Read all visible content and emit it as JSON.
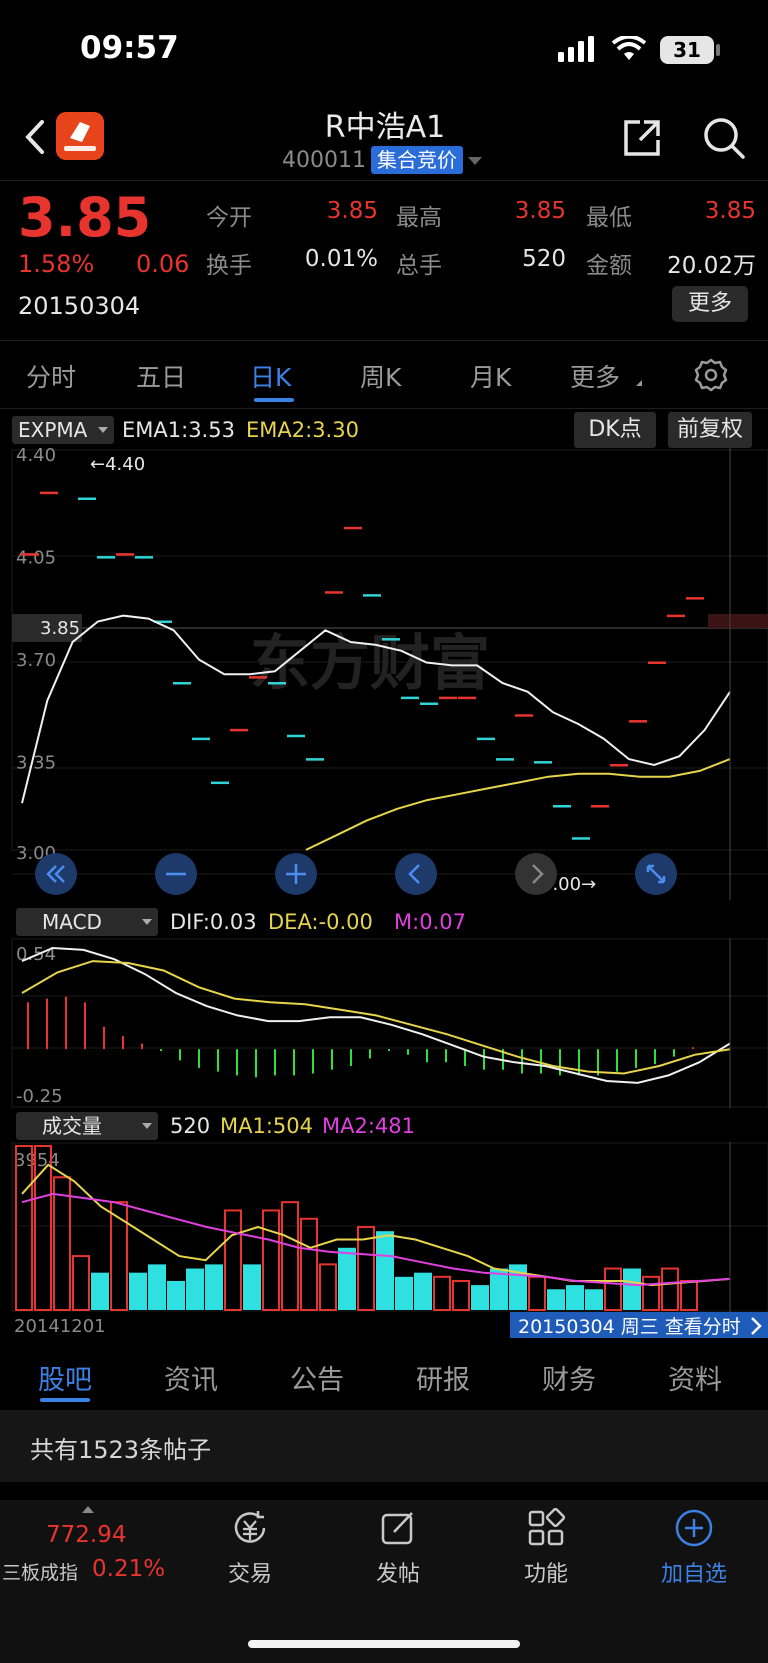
{
  "status_bar": {
    "time": "09:57",
    "battery": "31"
  },
  "header": {
    "title": "R中浩A1",
    "code": "400011",
    "badge": "集合竞价"
  },
  "quote": {
    "price": "3.85",
    "change_pct": "1.58%",
    "change": "0.06",
    "date": "20150304",
    "fields": [
      {
        "label": "今开",
        "value": "3.85",
        "color": "#e8342e"
      },
      {
        "label": "最高",
        "value": "3.85",
        "color": "#e8342e"
      },
      {
        "label": "最低",
        "value": "3.85",
        "color": "#e8342e"
      },
      {
        "label": "换手",
        "value": "0.01%",
        "color": "#e6e6e6"
      },
      {
        "label": "总手",
        "value": "520",
        "color": "#e6e6e6"
      },
      {
        "label": "金额",
        "value": "20.02万",
        "color": "#e6e6e6"
      }
    ],
    "more_label": "更多"
  },
  "ktabs": [
    "分时",
    "五日",
    "日K",
    "周K",
    "月K",
    "更多"
  ],
  "main_chart": {
    "indicator": "EXPMA",
    "ema1": "EMA1:3.53",
    "ema2": "EMA2:3.30",
    "dk_label": "DK点",
    "adjust_label": "前复权",
    "y_labels": [
      "4.40",
      "4.05",
      "3.70",
      "3.35",
      "3.00"
    ],
    "max_marker": "←4.40",
    "min_marker": "3.00→",
    "current_price": "3.85",
    "watermark": "东方财富"
  },
  "macd": {
    "indicator": "MACD",
    "dif": "DIF:0.03",
    "dea": "DEA:-0.00",
    "m": "M:0.07",
    "y_labels": [
      "0.54",
      "-0.25"
    ]
  },
  "volume": {
    "indicator": "成交量",
    "value": "520",
    "ma1": "MA1:504",
    "ma2": "MA2:481",
    "y_label": "3954",
    "start_date": "20141201",
    "end_label": "20150304 周三 查看分时"
  },
  "chart_data": {
    "type": "candlestick",
    "kline": [
      {
        "open": 4.0,
        "close": 4.0
      },
      {
        "open": 4.21,
        "close": 4.21
      },
      {
        "open": 4.4,
        "close": 4.4
      },
      {
        "open": 4.19,
        "close": 4.19
      },
      {
        "open": 3.99,
        "close": 3.99
      },
      {
        "open": 4.0,
        "close": 4.0
      },
      {
        "open": 3.99,
        "close": 3.99
      },
      {
        "open": 3.77,
        "close": 3.77
      },
      {
        "open": 3.56,
        "close": 3.56
      },
      {
        "open": 3.37,
        "close": 3.37
      },
      {
        "open": 3.22,
        "close": 3.22
      },
      {
        "open": 3.4,
        "close": 3.4
      },
      {
        "open": 3.58,
        "close": 3.58
      },
      {
        "open": 3.56,
        "close": 3.56
      },
      {
        "open": 3.38,
        "close": 3.38
      },
      {
        "open": 3.3,
        "close": 3.3
      },
      {
        "open": 3.87,
        "close": 3.87
      },
      {
        "open": 4.09,
        "close": 4.09
      },
      {
        "open": 3.86,
        "close": 3.86
      },
      {
        "open": 3.71,
        "close": 3.71
      },
      {
        "open": 3.51,
        "close": 3.51
      },
      {
        "open": 3.49,
        "close": 3.49
      },
      {
        "open": 3.51,
        "close": 3.51
      },
      {
        "open": 3.51,
        "close": 3.51
      },
      {
        "open": 3.37,
        "close": 3.37
      },
      {
        "open": 3.3,
        "close": 3.3
      },
      {
        "open": 3.45,
        "close": 3.45
      },
      {
        "open": 3.29,
        "close": 3.29
      },
      {
        "open": 3.14,
        "close": 3.14
      },
      {
        "open": 3.03,
        "close": 3.03
      },
      {
        "open": 3.14,
        "close": 3.14
      },
      {
        "open": 3.28,
        "close": 3.28
      },
      {
        "open": 3.43,
        "close": 3.43
      },
      {
        "open": 3.63,
        "close": 3.63
      },
      {
        "open": 3.79,
        "close": 3.79
      },
      {
        "open": 3.85,
        "close": 3.85
      }
    ],
    "ema1": [
      3.15,
      3.5,
      3.7,
      3.77,
      3.79,
      3.78,
      3.74,
      3.64,
      3.59,
      3.59,
      3.6,
      3.67,
      3.74,
      3.7,
      3.69,
      3.67,
      3.63,
      3.62,
      3.62,
      3.56,
      3.53,
      3.46,
      3.42,
      3.37,
      3.3,
      3.28,
      3.31,
      3.4,
      3.53
    ],
    "ema2": [
      2.99,
      3.04,
      3.09,
      3.13,
      3.16,
      3.18,
      3.2,
      3.22,
      3.24,
      3.25,
      3.25,
      3.24,
      3.24,
      3.26,
      3.3
    ],
    "macd_hist": [
      0.25,
      0.27,
      0.28,
      0.25,
      0.12,
      0.07,
      0.03,
      -0.01,
      -0.06,
      -0.1,
      -0.12,
      -0.14,
      -0.15,
      -0.14,
      -0.14,
      -0.13,
      -0.11,
      -0.09,
      -0.05,
      -0.01,
      -0.03,
      -0.07,
      -0.07,
      -0.09,
      -0.11,
      -0.11,
      -0.13,
      -0.13,
      -0.14,
      -0.14,
      -0.14,
      -0.12,
      -0.1,
      -0.08,
      -0.04,
      0.01
    ],
    "dif": [
      0.47,
      0.54,
      0.53,
      0.48,
      0.4,
      0.3,
      0.23,
      0.18,
      0.15,
      0.15,
      0.17,
      0.17,
      0.13,
      0.08,
      0.02,
      -0.04,
      -0.07,
      -0.09,
      -0.13,
      -0.17,
      -0.18,
      -0.14,
      -0.07,
      0.03
    ],
    "dea": [
      0.3,
      0.41,
      0.47,
      0.46,
      0.42,
      0.33,
      0.27,
      0.25,
      0.24,
      0.21,
      0.18,
      0.13,
      0.08,
      0.02,
      -0.04,
      -0.09,
      -0.12,
      -0.13,
      -0.09,
      -0.03,
      0.0
    ],
    "volume": [
      3954,
      3954,
      3200,
      1300,
      900,
      2600,
      900,
      1100,
      700,
      1000,
      1100,
      2400,
      1100,
      2400,
      2600,
      2200,
      1100,
      1500,
      2000,
      1900,
      800,
      900,
      800,
      700,
      600,
      1000,
      1100,
      800,
      500,
      600,
      500,
      1000,
      1000,
      800,
      1000,
      700
    ],
    "vol_colors": [
      "r",
      "r",
      "r",
      "r",
      "c",
      "r",
      "c",
      "c",
      "c",
      "c",
      "c",
      "r",
      "c",
      "r",
      "r",
      "r",
      "r",
      "c",
      "r",
      "c",
      "c",
      "c",
      "r",
      "r",
      "c",
      "c",
      "c",
      "r",
      "c",
      "c",
      "c",
      "r",
      "c",
      "r",
      "r",
      "r"
    ],
    "vol_ma1": [
      2800,
      3500,
      3100,
      2500,
      2100,
      1700,
      1300,
      1200,
      1800,
      2000,
      1800,
      1500,
      1700,
      1700,
      1800,
      1700,
      1500,
      1300,
      1000,
      900,
      800,
      700,
      700,
      700,
      600,
      650,
      700,
      750
    ],
    "vol_ma2": [
      2600,
      2800,
      2700,
      2600,
      2400,
      2200,
      2000,
      1850,
      1700,
      1500,
      1400,
      1350,
      1300,
      1150,
      1000,
      900,
      850,
      800,
      700,
      650,
      600,
      650,
      700,
      750
    ],
    "y_range": [
      3.0,
      4.4
    ],
    "macd_range": [
      -0.25,
      0.54
    ],
    "vol_max": 3954
  },
  "bottom_tabs": [
    "股吧",
    "资讯",
    "公告",
    "研报",
    "财务",
    "资料"
  ],
  "posts_count": "共有1523条帖子",
  "bottom_nav": {
    "index_value": "772.94",
    "index_name": "三板成指",
    "index_pct": "0.21%",
    "items": [
      "交易",
      "发帖",
      "功能",
      "加自选"
    ]
  }
}
